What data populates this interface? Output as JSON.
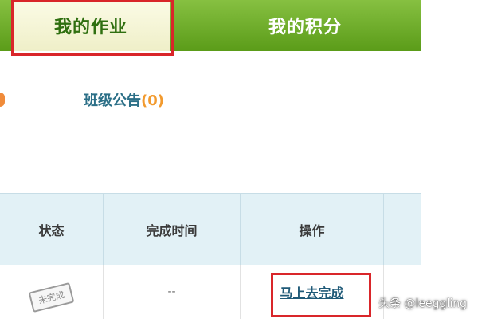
{
  "tabs": {
    "my_homework": "我的作业",
    "my_points": "我的积分"
  },
  "announcement": {
    "label": "班级公告",
    "count": "(0)"
  },
  "table": {
    "headers": {
      "status": "状态",
      "completion_time": "完成时间",
      "action": "操作"
    },
    "row": {
      "status": "未完成",
      "completion_time": "--",
      "action": "马上去完成"
    }
  },
  "watermark": "头条 @leeggling",
  "colors": {
    "tab_bar_green": "#6fae2c",
    "active_tab_bg": "#f4f4d6",
    "highlight_red": "#d9262a",
    "announcement_text": "#2b6f87",
    "announcement_count": "#f29a2e",
    "table_header_bg": "#e2f1f6"
  }
}
